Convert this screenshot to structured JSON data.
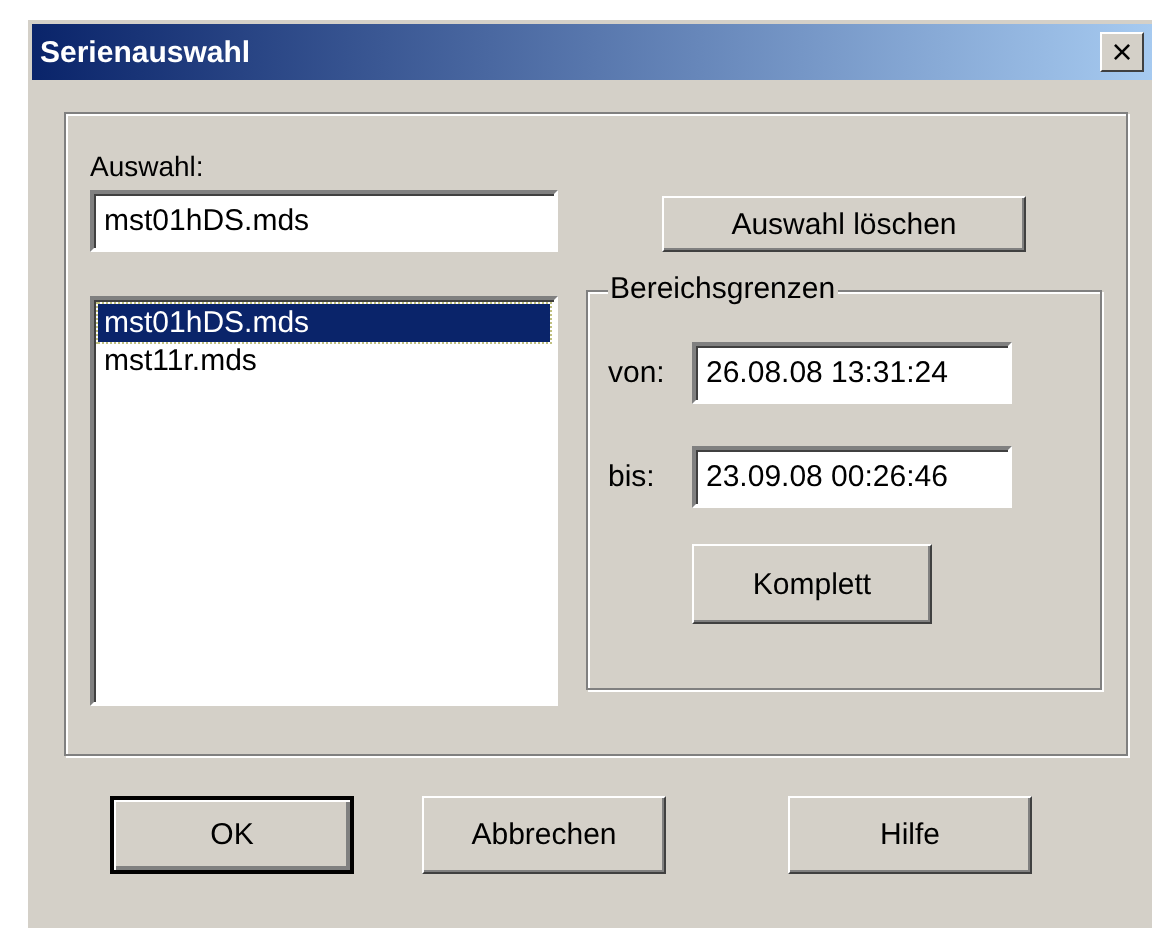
{
  "window": {
    "title": "Serienauswahl",
    "close": "×"
  },
  "selection": {
    "label": "Auswahl:",
    "value": "mst01hDS.mds"
  },
  "clear_button": "Auswahl löschen",
  "list": {
    "items": [
      {
        "label": "mst01hDS.mds",
        "selected": true
      },
      {
        "label": "mst11r.mds",
        "selected": false
      }
    ]
  },
  "range": {
    "title": "Bereichsgrenzen",
    "from_label": "von:",
    "from_value": "26.08.08 13:31:24",
    "to_label": "bis:",
    "to_value": "23.09.08 00:26:46",
    "button": "Komplett"
  },
  "buttons": [
    {
      "label": "OK",
      "default": true
    },
    {
      "label": "Abbrechen",
      "default": false
    },
    {
      "label": "Hilfe",
      "default": false
    }
  ]
}
